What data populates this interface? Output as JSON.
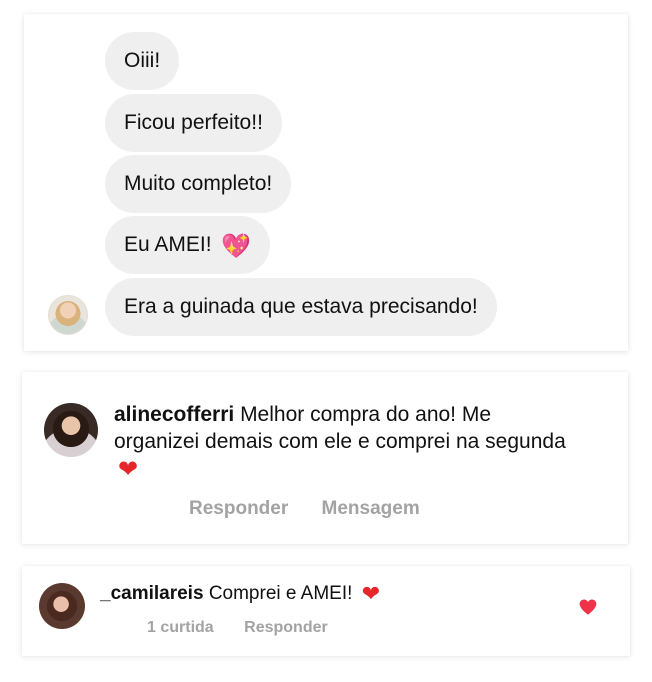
{
  "chat": {
    "messages": [
      "Oiii!",
      "Ficou perfeito!!",
      "Muito completo!",
      "Eu AMEI!",
      "Era a guinada que estava precisando!"
    ],
    "emoji_after_message_4": "💖"
  },
  "comments": [
    {
      "username": "alinecofferri",
      "text": "Melhor compra do ano! Me organizei demais com ele e comprei na segunda",
      "emoji": "❤",
      "actions": [
        "Responder",
        "Mensagem"
      ]
    },
    {
      "username": "_camilareis",
      "text": "Comprei e AMEI!",
      "emoji": "❤",
      "likes_label": "1 curtida",
      "reply_label": "Responder",
      "liked": true
    }
  ],
  "colors": {
    "bubble_bg": "#efefef",
    "action_text": "#a3a3a3",
    "heart_red": "#e5262b",
    "like_heart": "#f0324a"
  }
}
